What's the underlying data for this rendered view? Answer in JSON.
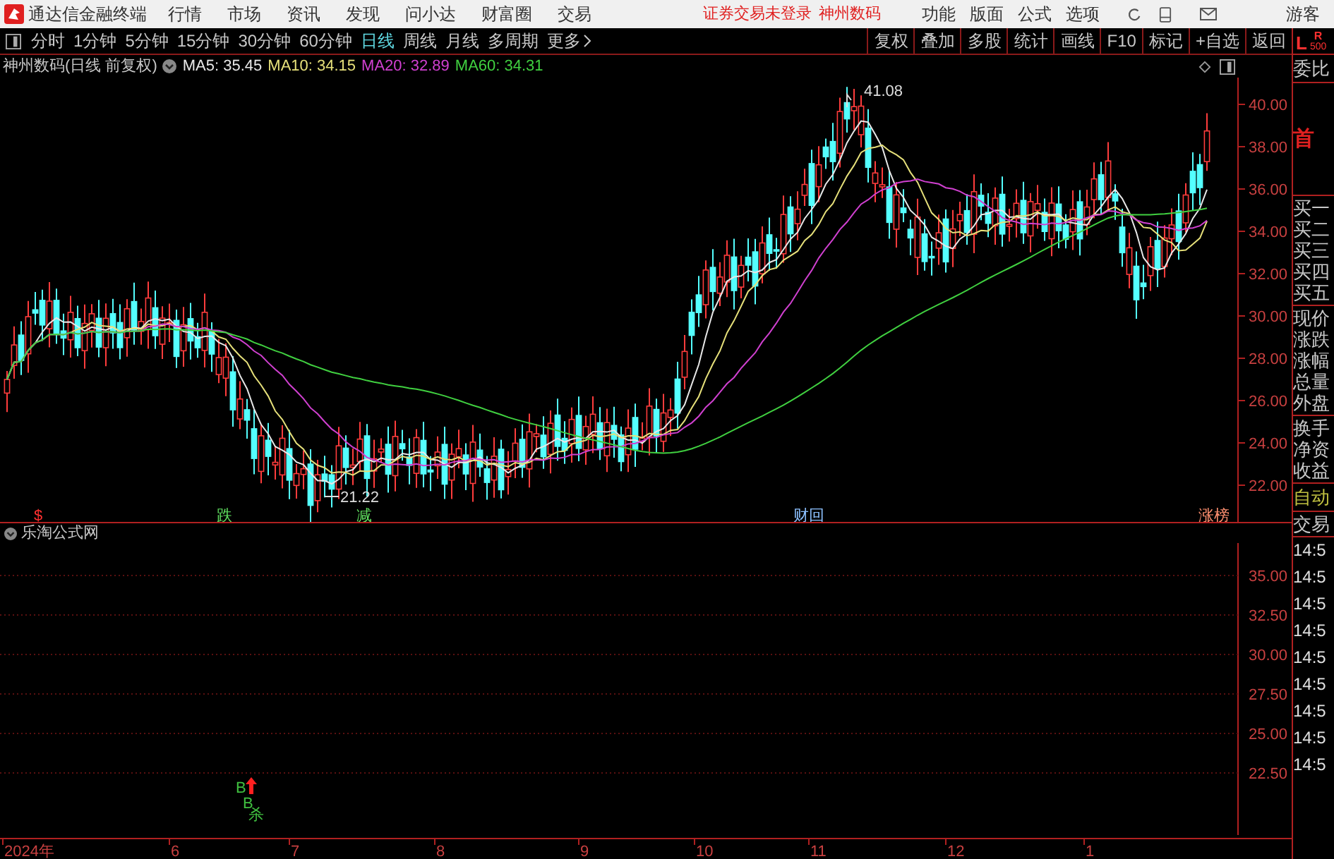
{
  "app": {
    "title": "通达信金融终端"
  },
  "menu": [
    "行情",
    "市场",
    "资讯",
    "发现",
    "问小达",
    "财富圈",
    "交易"
  ],
  "login_status": "证券交易未登录",
  "stock_link": "神州数码",
  "right_menu": [
    "功能",
    "版面",
    "公式",
    "选项"
  ],
  "user": "游客",
  "periods": [
    {
      "label": "分时",
      "selected": false
    },
    {
      "label": "1分钟",
      "selected": false
    },
    {
      "label": "5分钟",
      "selected": false
    },
    {
      "label": "15分钟",
      "selected": false
    },
    {
      "label": "30分钟",
      "selected": false
    },
    {
      "label": "60分钟",
      "selected": false
    },
    {
      "label": "日线",
      "selected": true
    },
    {
      "label": "周线",
      "selected": false
    },
    {
      "label": "月线",
      "selected": false
    },
    {
      "label": "多周期",
      "selected": false
    }
  ],
  "more": "更多",
  "tools": [
    "复权",
    "叠加",
    "多股",
    "统计",
    "画线",
    "F10",
    "标记",
    "+自选",
    "返回"
  ],
  "main_chart": {
    "stock": "神州数码(日线 前复权)",
    "ma": [
      {
        "label": "MA5: 35.45",
        "color": "#e8e8e8"
      },
      {
        "label": "MA10: 34.15",
        "color": "#e6e07a"
      },
      {
        "label": "MA20: 32.89",
        "color": "#d040d0"
      },
      {
        "label": "MA60: 34.31",
        "color": "#40d040"
      }
    ],
    "price_ticks": [
      "40.00",
      "38.00",
      "36.00",
      "34.00",
      "32.00",
      "30.00",
      "28.00",
      "26.00",
      "24.00",
      "22.00"
    ],
    "high_label": "41.08",
    "low_label": "21.22",
    "markers": [
      {
        "text": "$",
        "color": "#ff3030"
      },
      {
        "text": "跌",
        "color": "#60e060"
      },
      {
        "text": "减",
        "color": "#60e060"
      },
      {
        "text": "财回",
        "color": "#8cc0ff"
      },
      {
        "text": "涨榜",
        "color": "#ff9070"
      }
    ]
  },
  "indicator": {
    "title": "乐淘公式网",
    "ticks": [
      "35.00",
      "32.50",
      "30.00",
      "27.50",
      "25.00",
      "22.50"
    ],
    "signals": [
      {
        "text": "B",
        "color": "#40c040"
      },
      {
        "text": "B",
        "color": "#40c040"
      },
      {
        "text": "杀",
        "color": "#40c040"
      }
    ]
  },
  "time_axis": [
    "2024年",
    "6",
    "7",
    "8",
    "9",
    "10",
    "11",
    "12",
    "1"
  ],
  "quote_panel": {
    "l": "L",
    "r": "R",
    "count": "500",
    "order_ratio": "委比",
    "board": "首",
    "bids": [
      "买一",
      "买二",
      "买三",
      "买四",
      "买五"
    ],
    "quotes": [
      "现价",
      "涨跌",
      "涨幅",
      "总量",
      "外盘"
    ],
    "extras": [
      "换手",
      "净资",
      "收益"
    ],
    "auto": "自动",
    "trades_title": "交易",
    "trade_times": [
      "14:5",
      "14:5",
      "14:5",
      "14:5",
      "14:5",
      "14:5",
      "14:5",
      "14:5",
      "14:5"
    ]
  }
}
